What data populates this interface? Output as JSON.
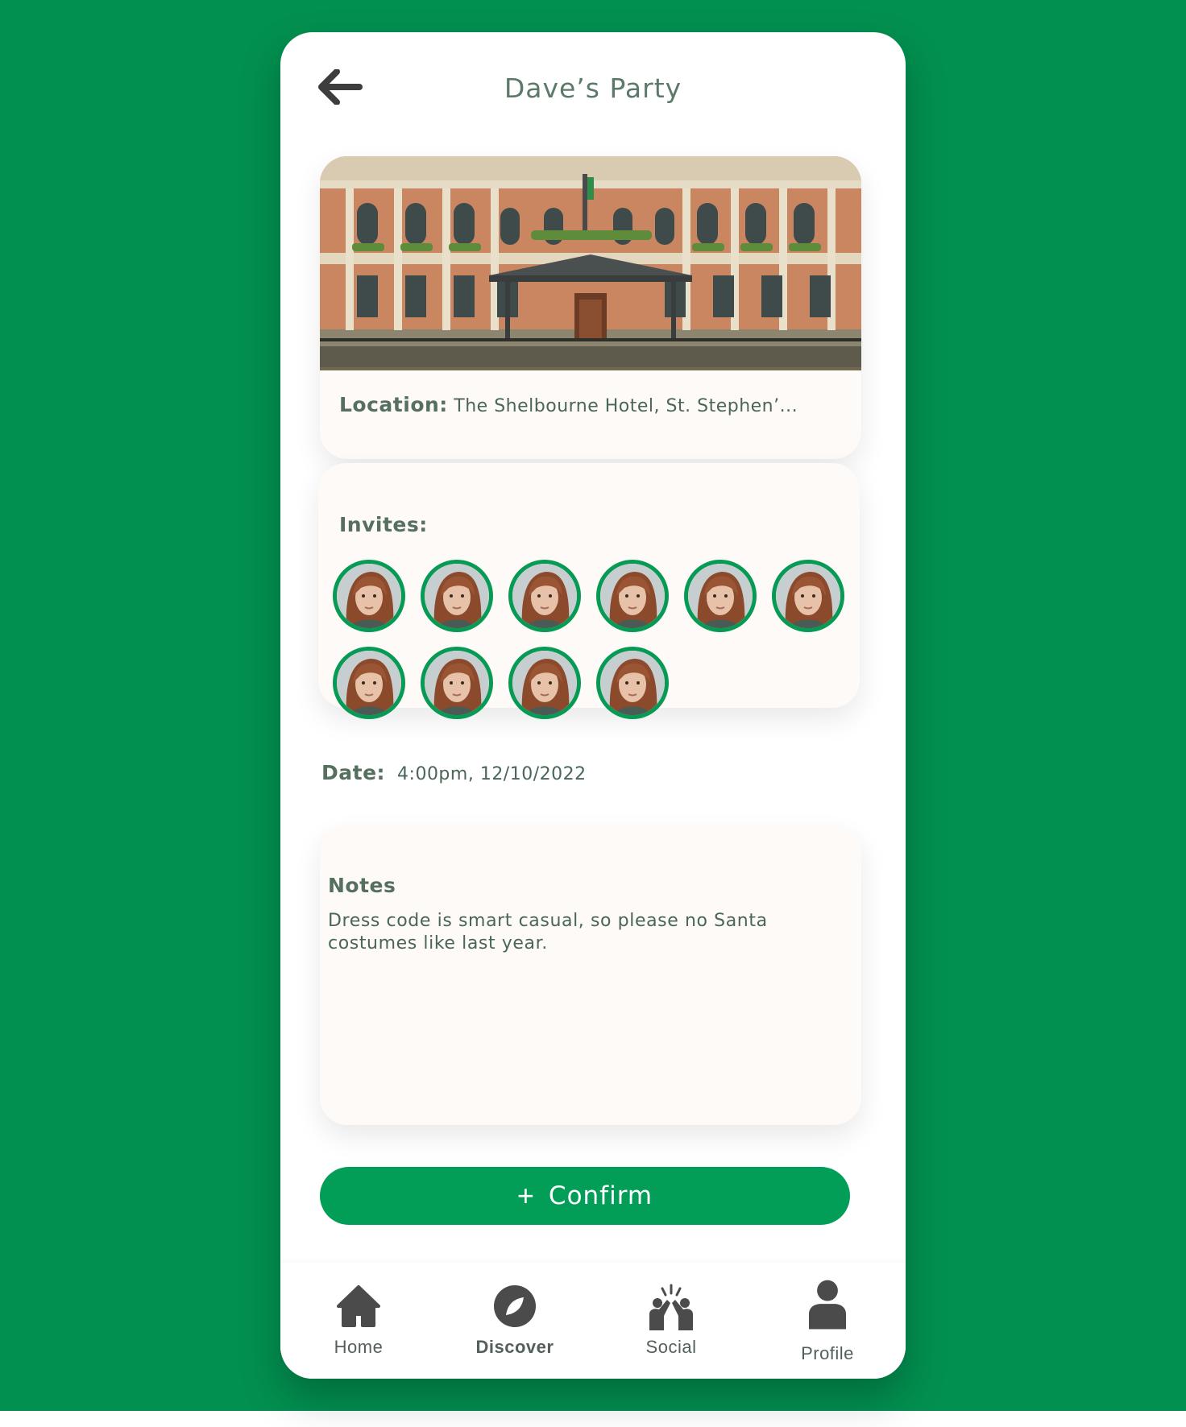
{
  "header": {
    "title": "Dave’s Party",
    "back_icon": "arrow-left-icon"
  },
  "location": {
    "label": "Location:",
    "value": "The Shelbourne Hotel, St. Stephen’..."
  },
  "invites": {
    "label": "Invites:",
    "count": 10
  },
  "date": {
    "label": "Date:",
    "value": "4:00pm, 12/10/2022"
  },
  "notes": {
    "title": "Notes",
    "text": "Dress code is smart casual, so please no Santa costumes like last year."
  },
  "confirm": {
    "label": "Confirm",
    "icon": "plus-icon"
  },
  "nav": {
    "items": [
      {
        "label": "Home",
        "icon": "home-icon"
      },
      {
        "label": "Discover",
        "icon": "compass-icon"
      },
      {
        "label": "Social",
        "icon": "social-icon"
      },
      {
        "label": "Profile",
        "icon": "person-icon"
      }
    ]
  },
  "colors": {
    "background": "#029050",
    "accent": "#029e57",
    "text": "#55705f",
    "card": "#fdfaf7"
  }
}
